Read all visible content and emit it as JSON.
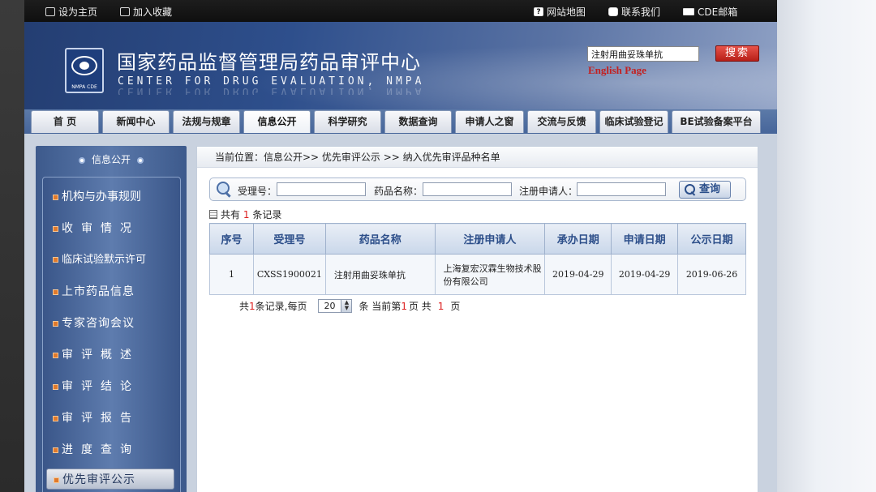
{
  "topbar": {
    "set_home": "设为主页",
    "add_fav": "加入收藏",
    "site_map": "网站地图",
    "contact": "联系我们",
    "cde_mail": "CDE邮箱"
  },
  "header": {
    "title_cn": "国家药品监督管理局药品审评中心",
    "title_en": "CENTER FOR DRUG EVALUATION, NMPA",
    "logo_caption": "NMPA CDE",
    "search_value": "注射用曲妥珠单抗",
    "search_button": "搜索",
    "english_page": "English Page"
  },
  "nav": {
    "tabs": [
      {
        "label": "首  页"
      },
      {
        "label": "新闻中心"
      },
      {
        "label": "法规与规章"
      },
      {
        "label": "信息公开"
      },
      {
        "label": "科学研究"
      },
      {
        "label": "数据查询"
      },
      {
        "label": "申请人之窗"
      },
      {
        "label": "交流与反馈"
      },
      {
        "label": "临床试验登记"
      },
      {
        "label": "BE试验备案平台"
      }
    ],
    "active_index": 3
  },
  "sidebar": {
    "title": "信息公开",
    "items": [
      {
        "label": "机构与办事规则"
      },
      {
        "label": "收审情况"
      },
      {
        "label": "临床试验默示许可"
      },
      {
        "label": "上市药品信息"
      },
      {
        "label": "专家咨询会议"
      },
      {
        "label": "审评概述"
      },
      {
        "label": "审评结论"
      },
      {
        "label": "审评报告"
      },
      {
        "label": "进度查询"
      },
      {
        "label": "优先审评公示"
      }
    ]
  },
  "content": {
    "breadcrumb": "当前位置：信息公开>> 优先审评公示 >> 纳入优先审评品种名单",
    "search": {
      "accept_no_label": "受理号：",
      "drug_name_label": "药品名称：",
      "applicant_label": "注册申请人：",
      "query_button": "查询"
    },
    "count_prefix": "共有",
    "count_value": "1",
    "count_suffix": "条记录",
    "table": {
      "headers": [
        "序号",
        "受理号",
        "药品名称",
        "注册申请人",
        "承办日期",
        "申请日期",
        "公示日期"
      ],
      "rows": [
        {
          "no": "1",
          "accept_no": "CXSS1900021",
          "drug_name": "注射用曲妥珠单抗",
          "applicant": "上海复宏汉霖生物技术股份有限公司",
          "handle_date": "2019-04-29",
          "apply_date": "2019-04-29",
          "publish_date": "2019-06-26"
        }
      ]
    },
    "pager": {
      "total_prefix": "共",
      "total_count": "1",
      "total_suffix": "条记录,每页",
      "page_size": "20",
      "unit": "条 当前第",
      "current_page": "1",
      "page_mid": "页 共",
      "total_pages": "1",
      "page_end": "页"
    }
  }
}
